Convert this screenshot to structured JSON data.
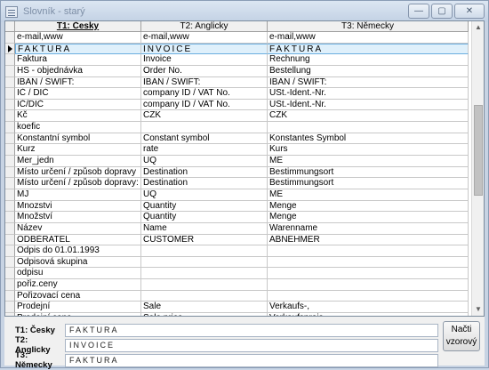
{
  "window": {
    "title": "Slovník - starý",
    "buttons": {
      "minimize": "—",
      "maximize": "▢",
      "close": "✕"
    }
  },
  "grid": {
    "columns": [
      "T1: Česky",
      "T2: Anglicky",
      "T3: Německy"
    ],
    "current_row_index": 1,
    "rows": [
      [
        "e-mail,www",
        "e-mail,www",
        "e-mail,www"
      ],
      [
        "FAKTURA",
        "INVOICE",
        "FAKTURA"
      ],
      [
        "Faktura",
        "Invoice",
        "Rechnung"
      ],
      [
        "HS - objednávka",
        "Order No.",
        "Bestellung"
      ],
      [
        "IBAN / SWIFT:",
        "IBAN / SWIFT:",
        "IBAN / SWIFT:"
      ],
      [
        "IČ / DIČ",
        "company ID / VAT No.",
        "USt.-Ident.-Nr."
      ],
      [
        "IČ/DIČ",
        "company ID / VAT No.",
        "USt.-Ident.-Nr."
      ],
      [
        "Kč",
        "CZK",
        "CZK"
      ],
      [
        "koefic",
        "",
        ""
      ],
      [
        "Konstantní symbol",
        "Constant symbol",
        "Konstantes Symbol"
      ],
      [
        "Kurz",
        "rate",
        "Kurs"
      ],
      [
        "Mer_jedn",
        "UQ",
        "ME"
      ],
      [
        "Místo určení / způsob dopravy",
        "Destination",
        "Bestimmungsort"
      ],
      [
        "Místo určení / způsob dopravy:",
        "Destination",
        "Bestimmungsort"
      ],
      [
        "MJ",
        "UQ",
        "ME"
      ],
      [
        "Mnozstvi",
        "Quantity",
        "Menge"
      ],
      [
        "Množství",
        "Quantity",
        "Menge"
      ],
      [
        "Název",
        "Name",
        "Warenname"
      ],
      [
        "ODBĚRATEL",
        "CUSTOMER",
        "ABNEHMER"
      ],
      [
        "Odpis do 01.01.1993",
        "",
        ""
      ],
      [
        "Odpisová skupina",
        "",
        ""
      ],
      [
        "odpisu",
        "",
        ""
      ],
      [
        "pořiz.ceny",
        "",
        ""
      ],
      [
        "Pořizovací cena",
        "",
        ""
      ],
      [
        "Prodejní",
        "Sale",
        "Verkaufs-,"
      ],
      [
        "Prodejní cena",
        "Sale price",
        "Verkaufspreis"
      ]
    ]
  },
  "form": {
    "fields": [
      {
        "label": "T1: Česky",
        "value": "FAKTURA"
      },
      {
        "label": "T2: Anglicky",
        "value": "INVOICE"
      },
      {
        "label": "T3: Německy",
        "value": "FAKTURA"
      }
    ],
    "button_label": "Načti vzorový"
  }
}
